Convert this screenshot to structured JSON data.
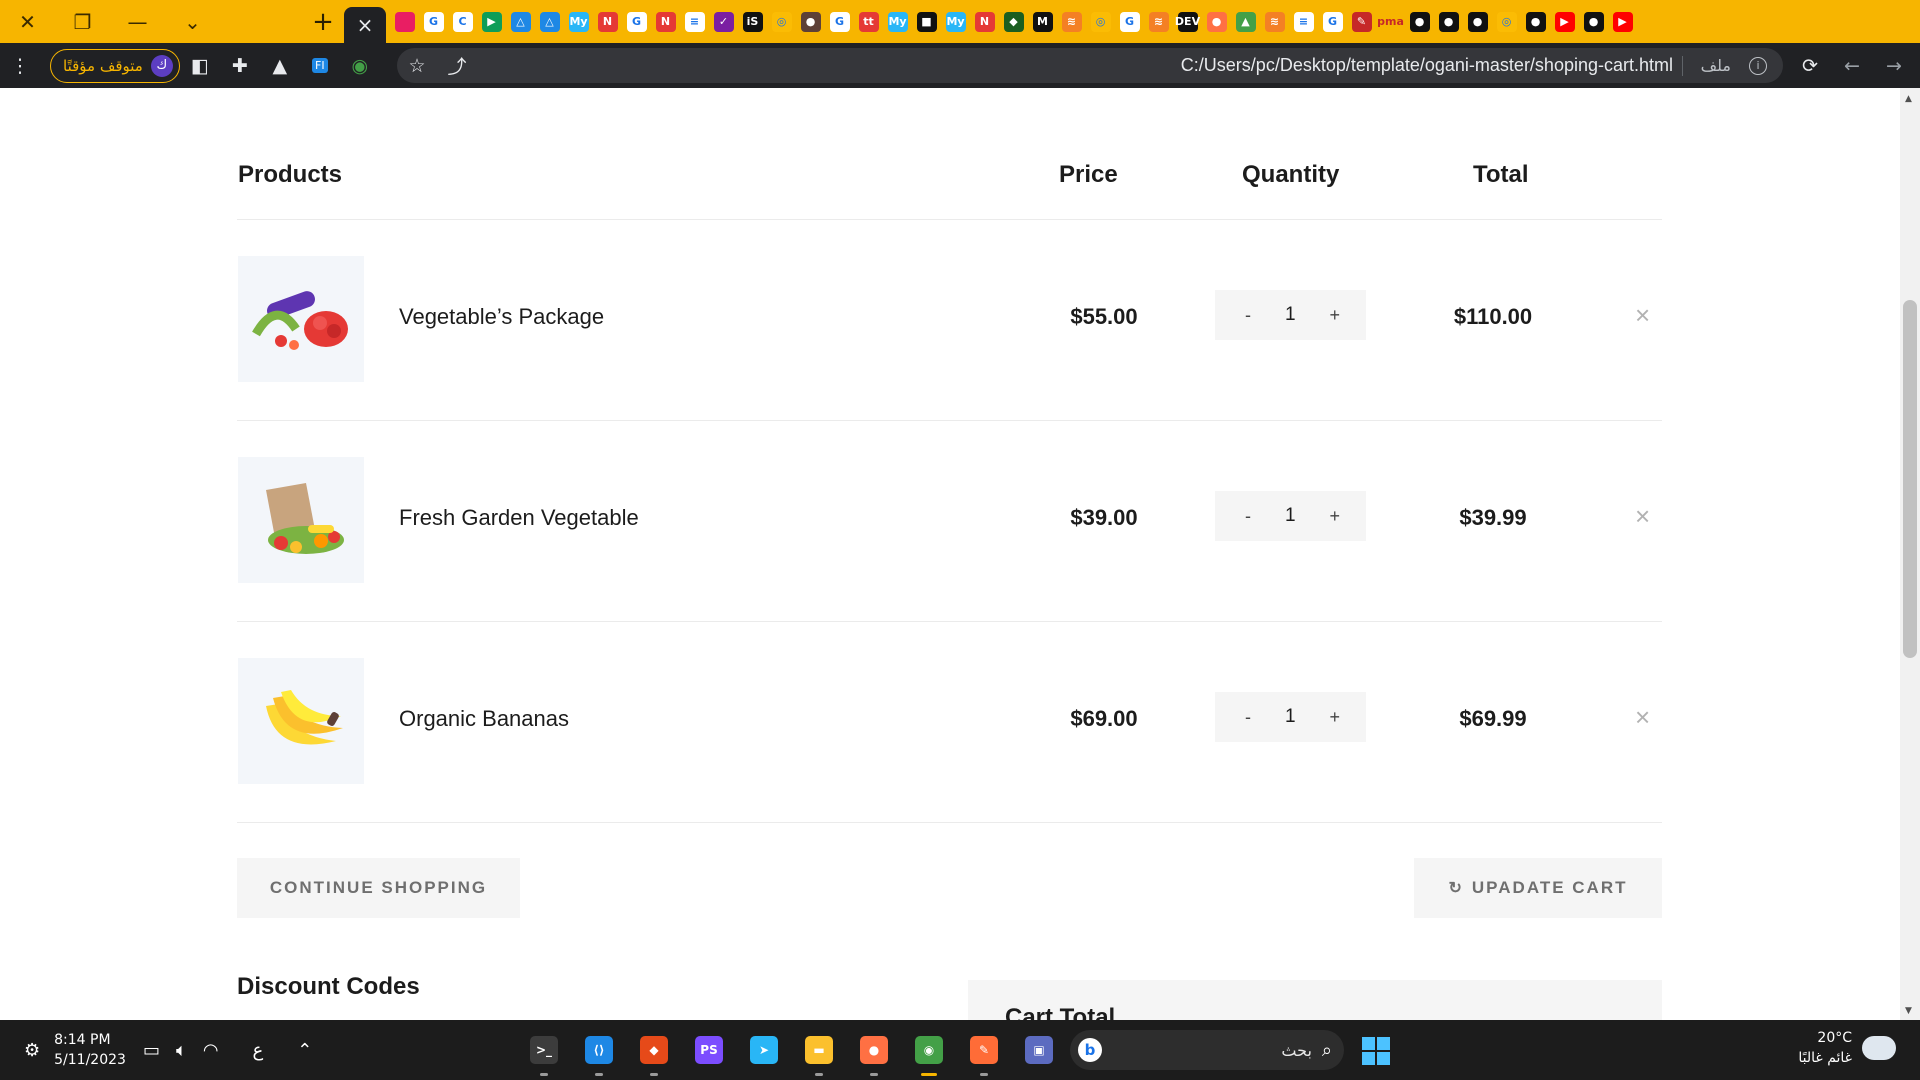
{
  "browser": {
    "url": "C:/Users/pc/Desktop/template/ogani-master/shoping-cart.html",
    "url_scheme_label": "ملف",
    "profile_label": "متوقف مؤقتًا",
    "profile_initial": "ك",
    "window_controls": [
      "close-icon",
      "restore-icon",
      "minimize-icon",
      "chevron-down-icon"
    ],
    "active_tab_close": "×",
    "tab_favicons": [
      {
        "icon": "flag-icon",
        "color": "#e91e63",
        "text": ""
      },
      {
        "icon": "google-icon",
        "color": "#ffffff",
        "text": "G"
      },
      {
        "icon": "c-icon",
        "color": "#ffffff",
        "text": "C"
      },
      {
        "icon": "play-icon",
        "color": "#0f9d58",
        "text": "▶"
      },
      {
        "icon": "drive-icon",
        "color": "#1e88e5",
        "text": "△"
      },
      {
        "icon": "drive-icon",
        "color": "#1e88e5",
        "text": "△"
      },
      {
        "icon": "my-icon",
        "color": "#29b6f6",
        "text": "My"
      },
      {
        "icon": "n-icon",
        "color": "#e53935",
        "text": "N"
      },
      {
        "icon": "google-icon",
        "color": "#ffffff",
        "text": "G"
      },
      {
        "icon": "n-icon",
        "color": "#e53935",
        "text": "N"
      },
      {
        "icon": "doc-icon",
        "color": "#ffffff",
        "text": "≡"
      },
      {
        "icon": "check-icon",
        "color": "#7b1fa2",
        "text": "✓"
      },
      {
        "icon": "is-icon",
        "color": "#111111",
        "text": "iS"
      },
      {
        "icon": "chrome-icon",
        "color": "#fbbc04",
        "text": "◎"
      },
      {
        "icon": "emblem-icon",
        "color": "#5d4037",
        "text": "●"
      },
      {
        "icon": "google-icon",
        "color": "#ffffff",
        "text": "G"
      },
      {
        "icon": "tt-icon",
        "color": "#e53935",
        "text": "tt"
      },
      {
        "icon": "my-icon",
        "color": "#29b6f6",
        "text": "My"
      },
      {
        "icon": "square-icon",
        "color": "#111111",
        "text": "■"
      },
      {
        "icon": "my-icon",
        "color": "#29b6f6",
        "text": "My"
      },
      {
        "icon": "n-icon",
        "color": "#e53935",
        "text": "N"
      },
      {
        "icon": "mongo-icon",
        "color": "#1b5e20",
        "text": "◆"
      },
      {
        "icon": "m-icon",
        "color": "#111111",
        "text": "M"
      },
      {
        "icon": "stack-icon",
        "color": "#f48024",
        "text": "≋"
      },
      {
        "icon": "chrome-icon",
        "color": "#fbbc04",
        "text": "◎"
      },
      {
        "icon": "google-icon",
        "color": "#ffffff",
        "text": "G"
      },
      {
        "icon": "stack-icon",
        "color": "#f48024",
        "text": "≋"
      },
      {
        "icon": "dev-icon",
        "color": "#111111",
        "text": "DEV"
      },
      {
        "icon": "ball-icon",
        "color": "#ff7043",
        "text": "●"
      },
      {
        "icon": "chart-icon",
        "color": "#43a047",
        "text": "▲"
      },
      {
        "icon": "stack-icon",
        "color": "#f48024",
        "text": "≋"
      },
      {
        "icon": "doc-icon",
        "color": "#ffffff",
        "text": "≡"
      },
      {
        "icon": "google-icon",
        "color": "#ffffff",
        "text": "G"
      },
      {
        "icon": "brush-icon",
        "color": "#c62828",
        "text": "✎"
      },
      {
        "icon": "pma-icon",
        "color": "#f7b500",
        "text": "pma"
      },
      {
        "icon": "github-icon",
        "color": "#111111",
        "text": "●"
      },
      {
        "icon": "github-icon",
        "color": "#111111",
        "text": "●"
      },
      {
        "icon": "github-icon",
        "color": "#111111",
        "text": "●"
      },
      {
        "icon": "chrome-icon",
        "color": "#fbbc04",
        "text": "◎"
      },
      {
        "icon": "github-icon",
        "color": "#111111",
        "text": "●"
      },
      {
        "icon": "youtube-icon",
        "color": "#ff0000",
        "text": "▶"
      },
      {
        "icon": "github-icon",
        "color": "#111111",
        "text": "●"
      },
      {
        "icon": "youtube-icon",
        "color": "#ff0000",
        "text": "▶"
      }
    ]
  },
  "cart": {
    "headers": {
      "products": "Products",
      "price": "Price",
      "quantity": "Quantity",
      "total": "Total"
    },
    "items": [
      {
        "name": "Vegetable’s Package",
        "price": "$55.00",
        "qty": "1",
        "total": "$110.00",
        "image": "vegetables-icon"
      },
      {
        "name": "Fresh Garden Vegetable",
        "price": "$39.00",
        "qty": "1",
        "total": "$39.99",
        "image": "grocery-bag-icon"
      },
      {
        "name": "Organic Bananas",
        "price": "$69.00",
        "qty": "1",
        "total": "$69.99",
        "image": "bananas-icon"
      }
    ],
    "qty_minus": "-",
    "qty_plus": "+",
    "remove_symbol": "×",
    "continue_label": "CONTINUE SHOPPING",
    "update_label": "UPADATE CART",
    "update_icon": "↻",
    "discount_title": "Discount Codes",
    "cart_total_title": "Cart Total"
  },
  "taskbar": {
    "time": "8:14 PM",
    "date": "5/11/2023",
    "lang": "ع",
    "search_text": "بحث",
    "weather_temp": "20°C",
    "weather_desc": "غائم غالبًا",
    "apps": [
      {
        "icon": "terminal-icon",
        "color": "#3c3c3c",
        "text": ">_"
      },
      {
        "icon": "vscode-icon",
        "color": "#1e88e5",
        "text": "⟨⟩"
      },
      {
        "icon": "git-icon",
        "color": "#e64a19",
        "text": "◆"
      },
      {
        "icon": "phpstorm-icon",
        "color": "#7c4dff",
        "text": "PS"
      },
      {
        "icon": "telegram-icon",
        "color": "#29b6f6",
        "text": "➤"
      },
      {
        "icon": "folder-icon",
        "color": "#fbc02d",
        "text": "▬"
      },
      {
        "icon": "firefox-icon",
        "color": "#ff7043",
        "text": "●"
      },
      {
        "icon": "chrome-icon",
        "color": "#43a047",
        "text": "◉"
      },
      {
        "icon": "postman-icon",
        "color": "#ff6c37",
        "text": "✎"
      },
      {
        "icon": "teams-icon",
        "color": "#5c6bc0",
        "text": "▣"
      }
    ]
  }
}
